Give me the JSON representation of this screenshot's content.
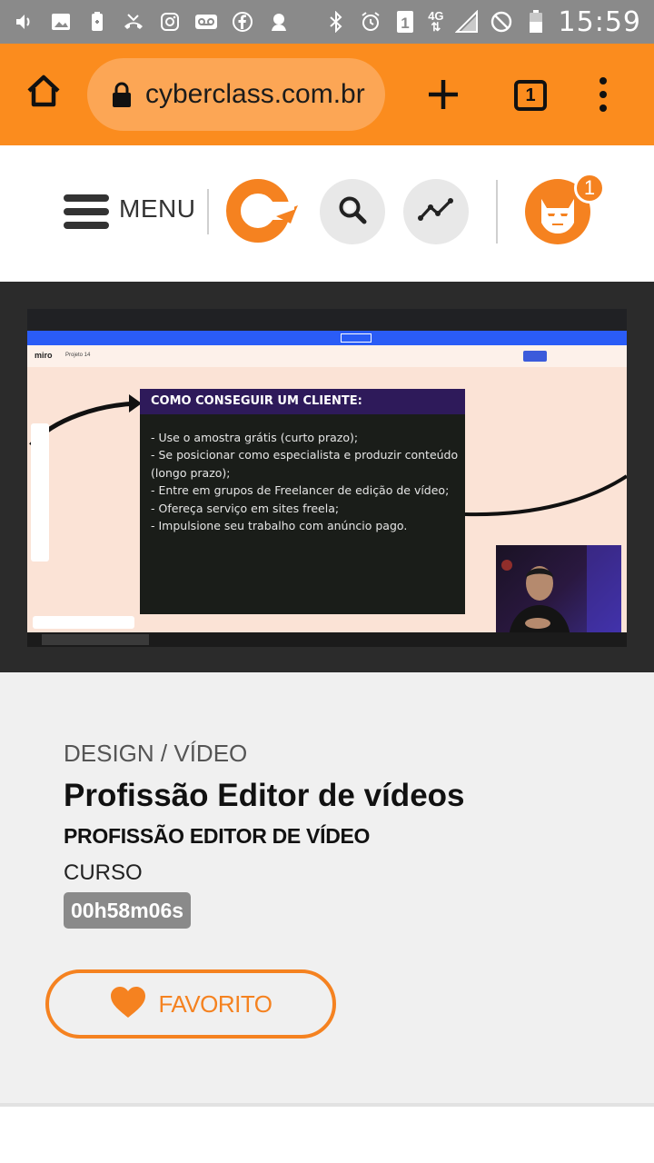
{
  "status_bar": {
    "time": "15:59",
    "network": "4G",
    "sim_slot": "1"
  },
  "browser": {
    "url": "cyberclass.com.br",
    "tab_count": "1",
    "accent_color": "#fb8c1e"
  },
  "site_header": {
    "menu_label": "MENU",
    "notification_count": "1",
    "brand_color": "#f58220"
  },
  "video": {
    "slide": {
      "heading": "COMO CONSEGUIR UM CLIENTE:",
      "lines": [
        "- Use o amostra grátis (curto prazo);",
        "- Se posicionar como especialista e produzir conteúdo (longo prazo);",
        "- Entre em grupos de Freelancer de edição de vídeo;",
        "- Ofereça serviço em sites freela;",
        "- Impulsione seu trabalho com anúncio pago."
      ]
    },
    "app_name": "miro",
    "board_name": "Projeto 14"
  },
  "course": {
    "category": "DESIGN / VÍDEO",
    "title": "Profissão Editor de vídeos",
    "subtitle": "PROFISSÃO EDITOR DE VÍDEO",
    "type": "CURSO",
    "duration": "00h58m06s"
  },
  "actions": {
    "favorite_label": "FAVORITO"
  }
}
